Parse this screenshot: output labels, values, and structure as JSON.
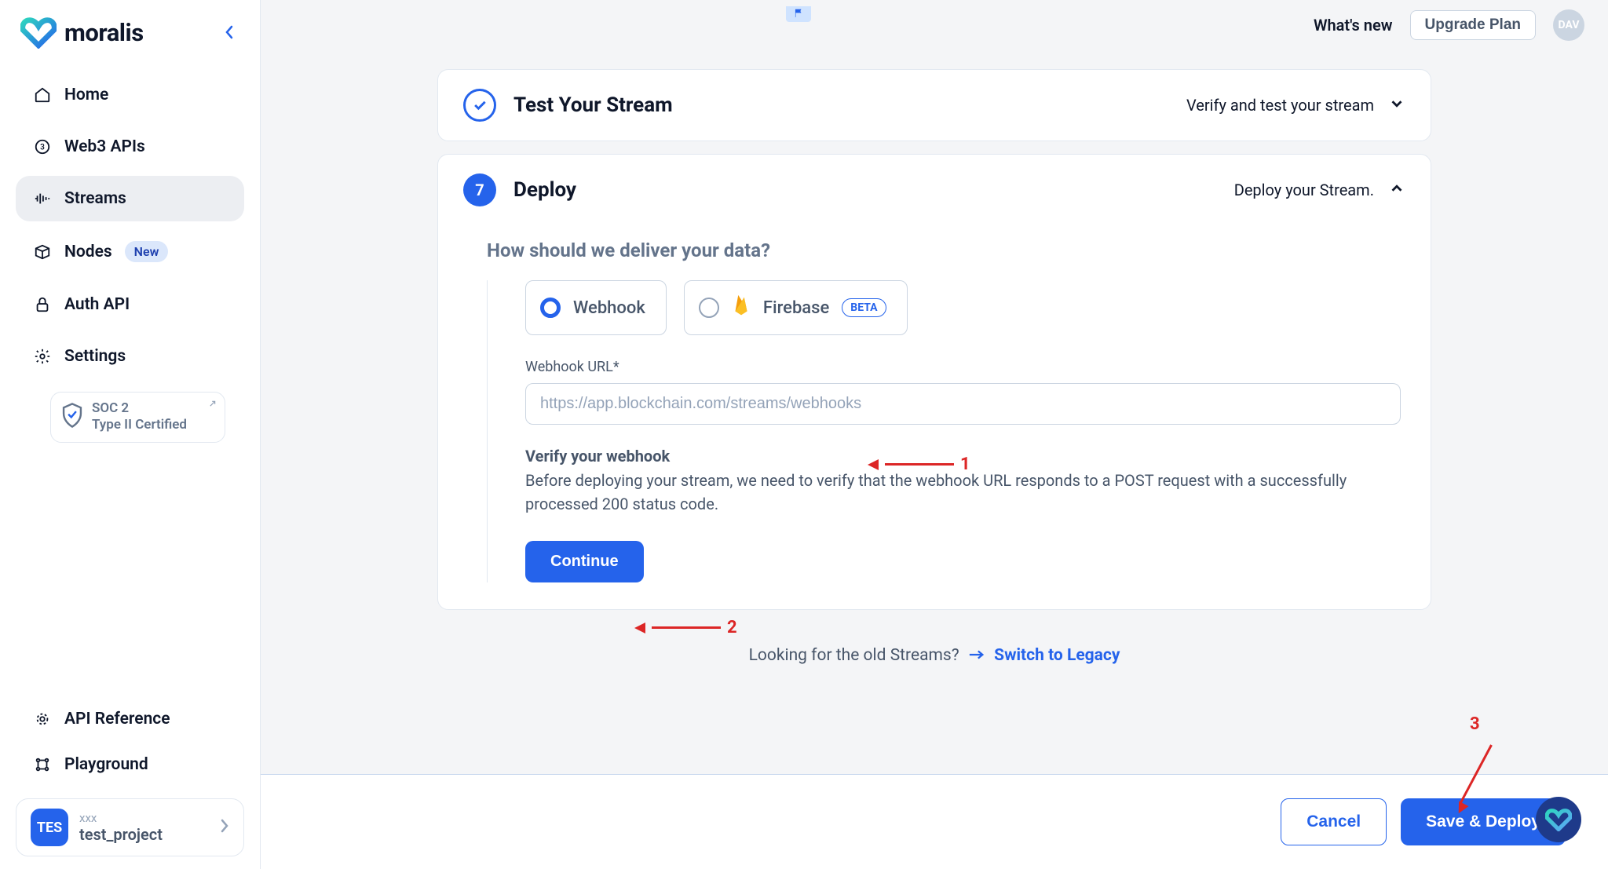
{
  "brand": {
    "name": "moralis"
  },
  "sidebar": {
    "items": [
      {
        "label": "Home",
        "icon": "home"
      },
      {
        "label": "Web3 APIs",
        "icon": "api"
      },
      {
        "label": "Streams",
        "icon": "streams"
      },
      {
        "label": "Nodes",
        "icon": "nodes",
        "badge": "New"
      },
      {
        "label": "Auth API",
        "icon": "lock"
      },
      {
        "label": "Settings",
        "icon": "gear"
      }
    ],
    "soc": {
      "line1": "SOC 2",
      "line2": "Type II Certified"
    },
    "bottom": [
      {
        "label": "API Reference",
        "icon": "gear-outline"
      },
      {
        "label": "Playground",
        "icon": "play"
      }
    ],
    "project": {
      "badge": "TES",
      "sub": "xxx",
      "name": "test_project"
    }
  },
  "topbar": {
    "whatsnew": "What's new",
    "upgrade": "Upgrade Plan",
    "avatar": "DAV"
  },
  "test_card": {
    "title": "Test Your Stream",
    "sub": "Verify and test your stream"
  },
  "deploy_card": {
    "step": "7",
    "title": "Deploy",
    "sub": "Deploy your Stream.",
    "question": "How should we deliver your data?",
    "options": {
      "webhook": "Webhook",
      "firebase": "Firebase",
      "beta": "BETA"
    },
    "field_label": "Webhook URL*",
    "placeholder": "https://app.blockchain.com/streams/webhooks",
    "verify_h": "Verify your webhook",
    "verify_p": "Before deploying your stream, we need to verify that the webhook URL responds to a POST request with a successfully processed 200 status code.",
    "continue": "Continue"
  },
  "legacy": {
    "text": "Looking for the old Streams?",
    "link": "Switch to Legacy"
  },
  "footer": {
    "cancel": "Cancel",
    "save": "Save & Deploy"
  },
  "annotations": {
    "a1": "1",
    "a2": "2",
    "a3": "3"
  }
}
